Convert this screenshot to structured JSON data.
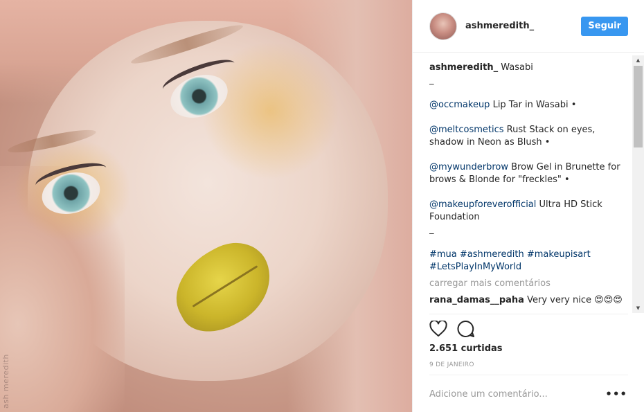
{
  "post": {
    "watermark": "ash meredith"
  },
  "header": {
    "username": "ashmeredith_",
    "follow_label": "Seguir"
  },
  "caption": {
    "author": "ashmeredith_",
    "title": "Wasabi",
    "separator_1": "_",
    "line_1_mention": "@occmakeup",
    "line_1_text": " Lip Tar in Wasabi •",
    "line_2_mention": "@meltcosmetics",
    "line_2_text": " Rust Stack on eyes, shadow in Neon as Blush •",
    "line_3_mention": "@mywunderbrow",
    "line_3_text": " Brow Gel in Brunette for brows & Blonde for \"freckles\" •",
    "line_4_mention": "@makeupforeverofficial",
    "line_4_text": " Ultra HD Stick Foundation",
    "separator_2": "_",
    "hashtags_line_1": "#mua #ashmeredith #makeupisart",
    "hashtags_line_2": "#LetsPlayInMyWorld"
  },
  "comments": {
    "load_more": "carregar mais comentários",
    "items": [
      {
        "author": "rana_damas__paha",
        "text": "Very very nice 😍😍😍"
      }
    ]
  },
  "actions": {
    "like_icon": "heart-icon",
    "comment_icon": "comment-icon"
  },
  "stats": {
    "likes": "2.651 curtidas",
    "date": "9 DE JANEIRO"
  },
  "composer": {
    "placeholder": "Adicione um comentário...",
    "more_options": "•••"
  },
  "colors": {
    "accent": "#3897f0",
    "mention": "#003569",
    "muted": "#999999",
    "text": "#262626"
  }
}
